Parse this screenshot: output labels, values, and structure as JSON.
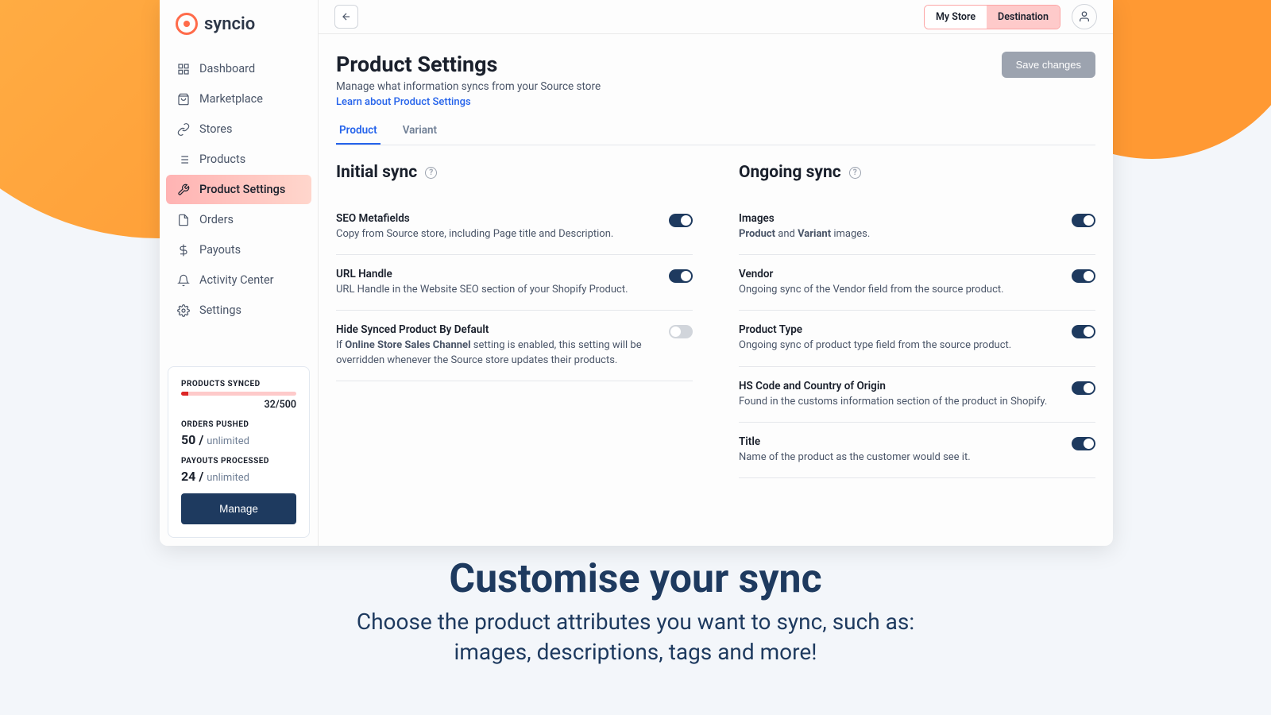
{
  "brand": "syncio",
  "nav": {
    "items": [
      {
        "label": "Dashboard"
      },
      {
        "label": "Marketplace"
      },
      {
        "label": "Stores"
      },
      {
        "label": "Products"
      },
      {
        "label": "Product Settings"
      },
      {
        "label": "Orders"
      },
      {
        "label": "Payouts"
      },
      {
        "label": "Activity Center"
      },
      {
        "label": "Settings"
      }
    ]
  },
  "stats": {
    "products_label": "PRODUCTS SYNCED",
    "products_value": "32/500",
    "orders_label": "ORDERS PUSHED",
    "orders_count": "50 /",
    "orders_limit": "unlimited",
    "payouts_label": "PAYOUTS PROCESSED",
    "payouts_count": "24 /",
    "payouts_limit": "unlimited",
    "manage": "Manage"
  },
  "topbar": {
    "my_store": "My Store",
    "destination": "Destination"
  },
  "page": {
    "title": "Product Settings",
    "subtitle": "Manage what information syncs from your Source store",
    "learn": "Learn about Product Settings",
    "save": "Save changes"
  },
  "tabs": {
    "product": "Product",
    "variant": "Variant"
  },
  "initial": {
    "title": "Initial sync",
    "items": [
      {
        "title": "SEO Metafields",
        "desc": "Copy from Source store, including Page title and Description.",
        "on": true
      },
      {
        "title": "URL Handle",
        "desc": "URL Handle in the Website SEO section of your Shopify Product.",
        "on": true
      },
      {
        "title": "Hide Synced Product By Default",
        "desc_pre": "If ",
        "desc_bold": "Online Store Sales Channel",
        "desc_post": " setting is enabled, this setting will be overridden whenever the Source store updates their products.",
        "on": false
      }
    ]
  },
  "ongoing": {
    "title": "Ongoing sync",
    "items": [
      {
        "title": "Images",
        "desc_b1": "Product",
        "desc_mid": " and ",
        "desc_b2": "Variant",
        "desc_end": " images.",
        "on": true
      },
      {
        "title": "Vendor",
        "desc": "Ongoing sync of the Vendor field from the source product.",
        "on": true
      },
      {
        "title": "Product Type",
        "desc": "Ongoing sync of product type field from the source product.",
        "on": true
      },
      {
        "title": "HS Code and Country of Origin",
        "desc": "Found in the customs information section of the product in Shopify.",
        "on": true
      },
      {
        "title": "Title",
        "desc": "Name of the product as the customer would see it.",
        "on": true
      }
    ]
  },
  "hero": {
    "title": "Customise your sync",
    "line1": "Choose the product attributes you want to sync, such as:",
    "line2": "images, descriptions, tags and more!"
  }
}
